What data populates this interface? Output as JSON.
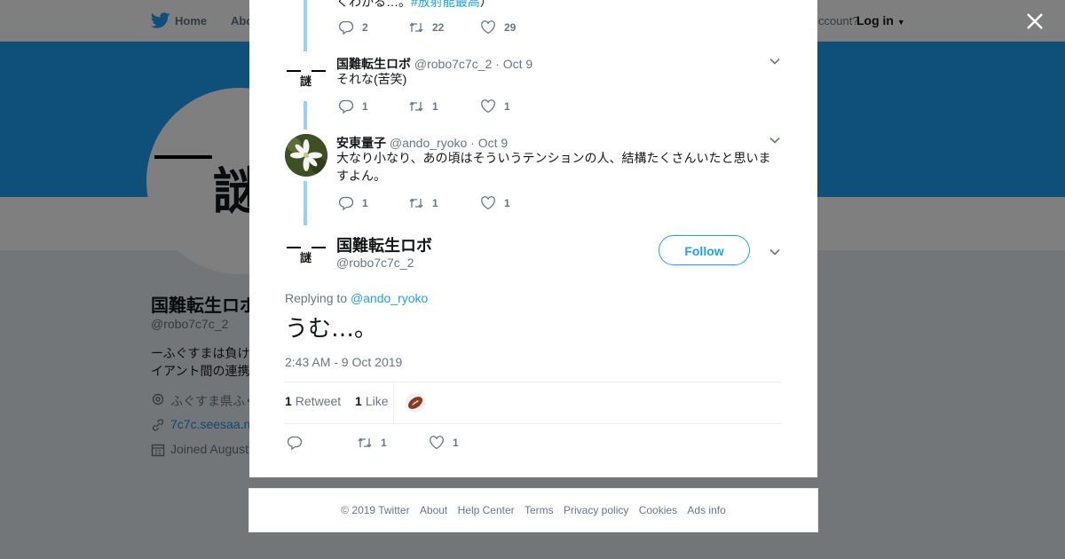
{
  "background": {
    "nav": {
      "home": "Home",
      "about": "Abo",
      "account_prompt": "ccount?",
      "login": "Log in"
    },
    "profile": {
      "name": "国難転生ロボ",
      "handle": "@robo7c7c_2",
      "bio_line1": "ーふぐすまは負け",
      "bio_line2": "イアント間の連携",
      "location": "ふぐすま県ふく",
      "url": "7c7c.seesaa.n",
      "joined": "Joined August"
    },
    "colors": {
      "banner": "#1da1f2",
      "link": "#1b95e0"
    }
  },
  "modal": {
    "top_tweet": {
      "text_partial": "くわかる…。",
      "hashtag": "#放射能最高",
      "text_end": "）",
      "replies": "2",
      "retweets": "22",
      "likes": "29"
    },
    "tweets": [
      {
        "name": "国難転生ロボ",
        "handle": "@robo7c7c_2",
        "date": "Oct 9",
        "text": "それな(苦笑)",
        "replies": "1",
        "retweets": "1",
        "likes": "1"
      },
      {
        "name": "安東量子",
        "handle": "@ando_ryoko",
        "date": "Oct 9",
        "text": "大なり小なり、あの頃はそういうテンションの人、結構たくさんいたと思いますよん。",
        "replies": "1",
        "retweets": "1",
        "likes": "1"
      }
    ],
    "main_tweet": {
      "name": "国難転生ロボ",
      "handle": "@robo7c7c_2",
      "follow_label": "Follow",
      "replying_prefix": "Replying to",
      "replying_to": "@ando_ryoko",
      "text": "うむ…。",
      "timestamp": "2:43 AM - 9 Oct 2019",
      "retweet_count": "1",
      "retweet_label": "Retweet",
      "like_count": "1",
      "like_label": "Like",
      "action_retweets": "1",
      "action_likes": "1"
    },
    "avatar_glyph": "謎"
  },
  "footer": {
    "items": [
      "© 2019 Twitter",
      "About",
      "Help Center",
      "Terms",
      "Privacy policy",
      "Cookies",
      "Ads info"
    ]
  }
}
